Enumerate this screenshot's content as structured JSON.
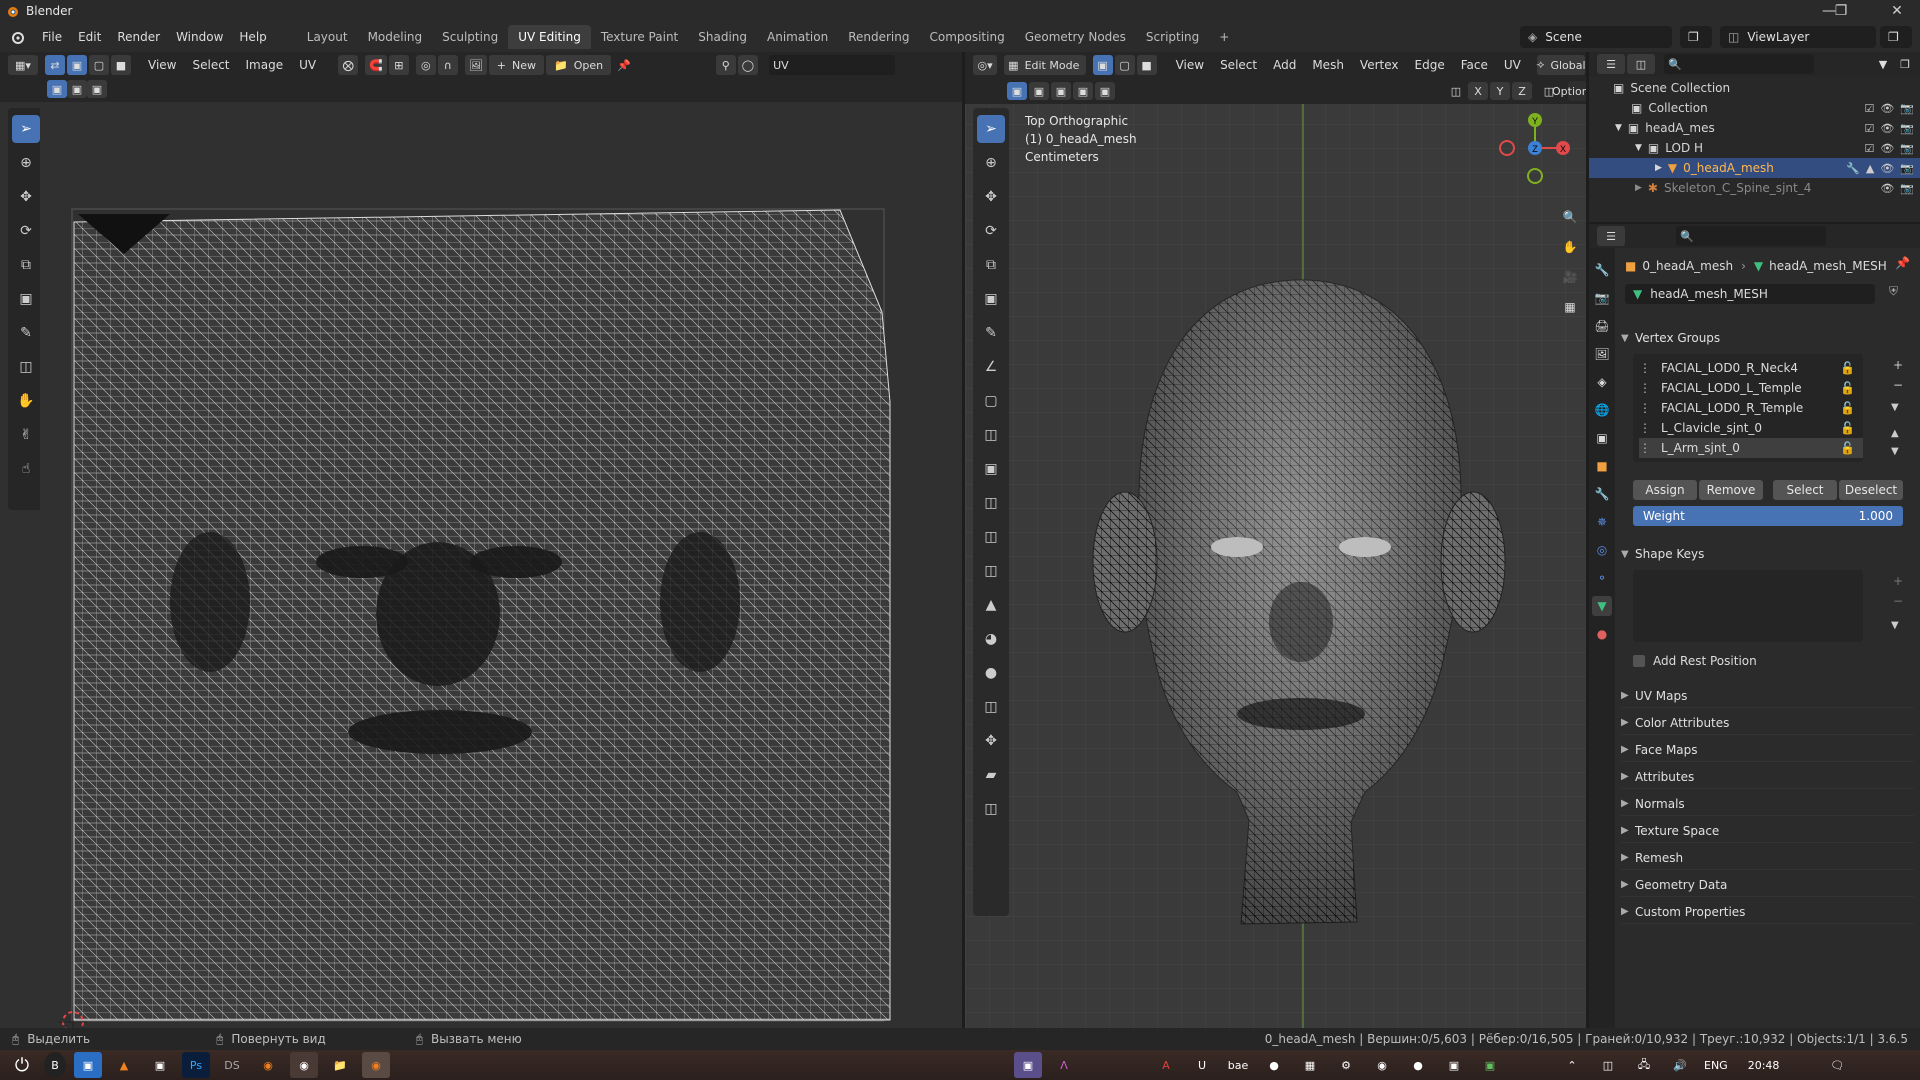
{
  "window": {
    "title": "Blender"
  },
  "menu": [
    "File",
    "Edit",
    "Render",
    "Window",
    "Help"
  ],
  "workspaces": [
    "Layout",
    "Modeling",
    "Sculpting",
    "UV Editing",
    "Texture Paint",
    "Shading",
    "Animation",
    "Rendering",
    "Compositing",
    "Geometry Nodes",
    "Scripting"
  ],
  "active_workspace": "UV Editing",
  "scene": "Scene",
  "view_layer": "ViewLayer",
  "uv_editor": {
    "menus": [
      "View",
      "Select",
      "Image",
      "UV"
    ],
    "new_label": "New",
    "open_label": "Open",
    "uv_map": "UV"
  },
  "viewport": {
    "mode": "Edit Mode",
    "menus": [
      "View",
      "Select",
      "Add",
      "Mesh",
      "Vertex",
      "Edge",
      "Face",
      "UV"
    ],
    "orientation": "Global",
    "options_label": "Options",
    "axes": [
      "X",
      "Y",
      "Z"
    ],
    "overlay_lines": [
      "Top Orthographic",
      "(1) 0_headA_mesh",
      "Centimeters"
    ],
    "gizmo": {
      "x": "X",
      "y": "Y",
      "z": "Z"
    }
  },
  "outliner": {
    "rows": [
      {
        "label": "Scene Collection",
        "indent": 0
      },
      {
        "label": "Collection",
        "indent": 1
      },
      {
        "label": "headA_mes",
        "indent": 1
      },
      {
        "label": "LOD H",
        "indent": 2
      },
      {
        "label": "0_headA_mesh",
        "indent": 3,
        "selected": true
      },
      {
        "label": "Skeleton_C_Spine_sjnt_4",
        "indent": 2
      }
    ]
  },
  "properties": {
    "breadcrumb_object": "0_headA_mesh",
    "breadcrumb_data": "headA_mesh_MESH",
    "mesh_name": "headA_mesh_MESH",
    "vertex_groups_label": "Vertex Groups",
    "vertex_groups": [
      "FACIAL_LOD0_R_Neck4",
      "FACIAL_LOD0_L_Temple",
      "FACIAL_LOD0_R_Temple",
      "L_Clavicle_sjnt_0",
      "L_Arm_sjnt_0"
    ],
    "buttons": [
      "Assign",
      "Remove",
      "Select",
      "Deselect"
    ],
    "weight_label": "Weight",
    "weight_value": "1.000",
    "shape_keys_label": "Shape Keys",
    "add_rest_position": "Add Rest Position",
    "collapsed_panels": [
      "UV Maps",
      "Color Attributes",
      "Face Maps",
      "Attributes",
      "Normals",
      "Texture Space",
      "Remesh",
      "Geometry Data",
      "Custom Properties"
    ]
  },
  "status": {
    "left1": "Выделить",
    "left2": "Повернуть вид",
    "left3": "Вызвать меню",
    "right": "0_headA_mesh | Вершин:0/5,603 | Рёбер:0/16,505 | Граней:0/10,932 | Треуг.:10,932 | Objects:1/1 | 3.6.5"
  },
  "taskbar": {
    "lang": "ENG",
    "time": "20:48"
  },
  "colors": {
    "accent": "#4772b3",
    "selection": "#334d80",
    "header": "#262626",
    "panel": "#2b2b2b"
  }
}
